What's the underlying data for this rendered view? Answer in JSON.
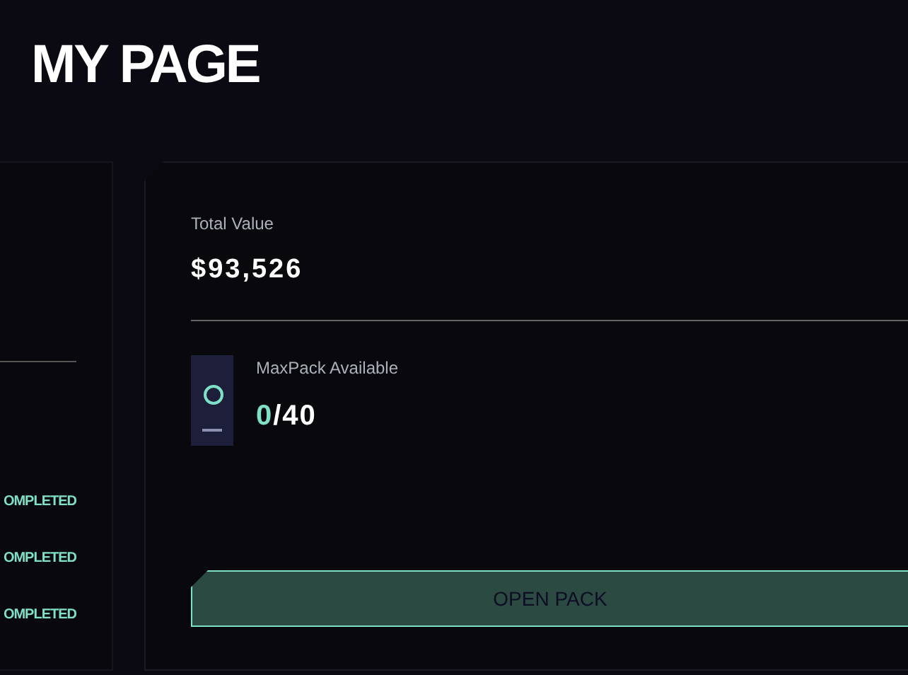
{
  "page_title": "MY PAGE",
  "side_panel": {
    "statuses": [
      "OMPLETED",
      "OMPLETED",
      "OMPLETED"
    ]
  },
  "summary": {
    "total_label": "Total Value",
    "total_value": "$93,526",
    "pack_label": "MaxPack Available",
    "pack_opened": "0",
    "pack_total": "/40"
  },
  "open_button": {
    "label": "OPEN PACK",
    "disabled": true
  }
}
